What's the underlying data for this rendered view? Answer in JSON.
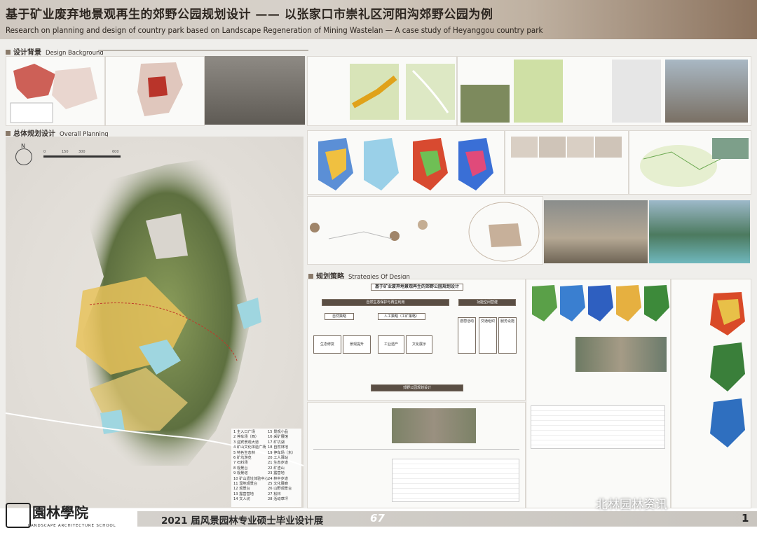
{
  "header": {
    "title_cn": "基于矿业废弃地景观再生的郊野公园规划设计 —— 以张家口市崇礼区河阳沟郊野公园为例",
    "title_en": "Research on planning and design of country park based on Landscape Regeneration of Mining Wastelan — A case study of Heyanggou country park"
  },
  "sections": {
    "background": {
      "cn": "设计背景",
      "en": "Design Background"
    },
    "overall": {
      "cn": "总体规划设计",
      "en": "Overall Planning"
    },
    "strategy": {
      "cn": "规划策略",
      "en": "Strategies Of Design"
    }
  },
  "map": {
    "north": "N",
    "scale": [
      "0",
      "150",
      "300",
      "600"
    ],
    "legend": [
      "1 主入口广场",
      "2 停车场（西）",
      "3 迎宾景观大道",
      "4 矿山文化体验广场",
      "5 特色生态林",
      "6 矿坑游览",
      "7 石料场",
      "8 观景台",
      "9 观景塔",
      "10 矿山遗址体验中心",
      "11 湿地观景台",
      "12 观景台",
      "13 露营营地",
      "14 文人坊",
      "15 景观小品",
      "16 采矿展馆",
      "17 矿坑湖",
      "18 自然林地",
      "19 停车场（东）",
      "20 工人驿站",
      "21 生态步道",
      "22 矿渣山",
      "23 露营地",
      "24 林中步道",
      "25 文化展廊",
      "26 山野观景台",
      "27 松林",
      "28 活动草坪"
    ]
  },
  "strategy_chart": {
    "title": "基于矿业废弃地景观再生的郊野公园规划设计",
    "boxes": [
      "自然生态保护与再生利用",
      "功能空间营建",
      "自然策略",
      "人工策略（工矿策略）",
      "生态修复",
      "景观提升",
      "工业遗产",
      "文化展示",
      "游憩活动",
      "交通组织",
      "服务设施",
      "郊野公园规划设计"
    ]
  },
  "footer": {
    "logo_cn": "園林學院",
    "logo_en": "LANDSCAPE ARCHITECTURE SCHOOL",
    "exhibition": "2021 届风景园林专业硕士毕业设计展",
    "number": "67",
    "page": "1",
    "watermark": "北林园林资讯"
  },
  "colors": {
    "terrain_green": "#6f8a4a",
    "yellow_field": "#e8c25a",
    "water": "#9fd6e0",
    "accent": "#8a7a6a"
  }
}
